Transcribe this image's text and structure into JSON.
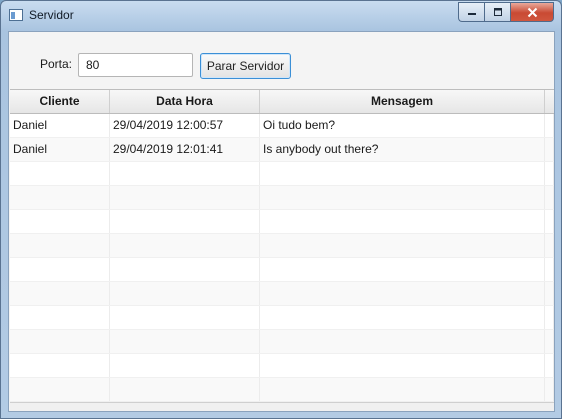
{
  "window": {
    "title": "Servidor"
  },
  "form": {
    "port_label": "Porta:",
    "port_value": "80",
    "stop_button_label": "Parar Servidor"
  },
  "table": {
    "columns": [
      "Cliente",
      "Data Hora",
      "Mensagem"
    ],
    "rows": [
      {
        "cliente": "Daniel",
        "data_hora": "29/04/2019 12:00:57",
        "mensagem": "Oi tudo bem?"
      },
      {
        "cliente": "Daniel",
        "data_hora": "29/04/2019 12:01:41",
        "mensagem": "Is anybody out there?"
      }
    ]
  }
}
